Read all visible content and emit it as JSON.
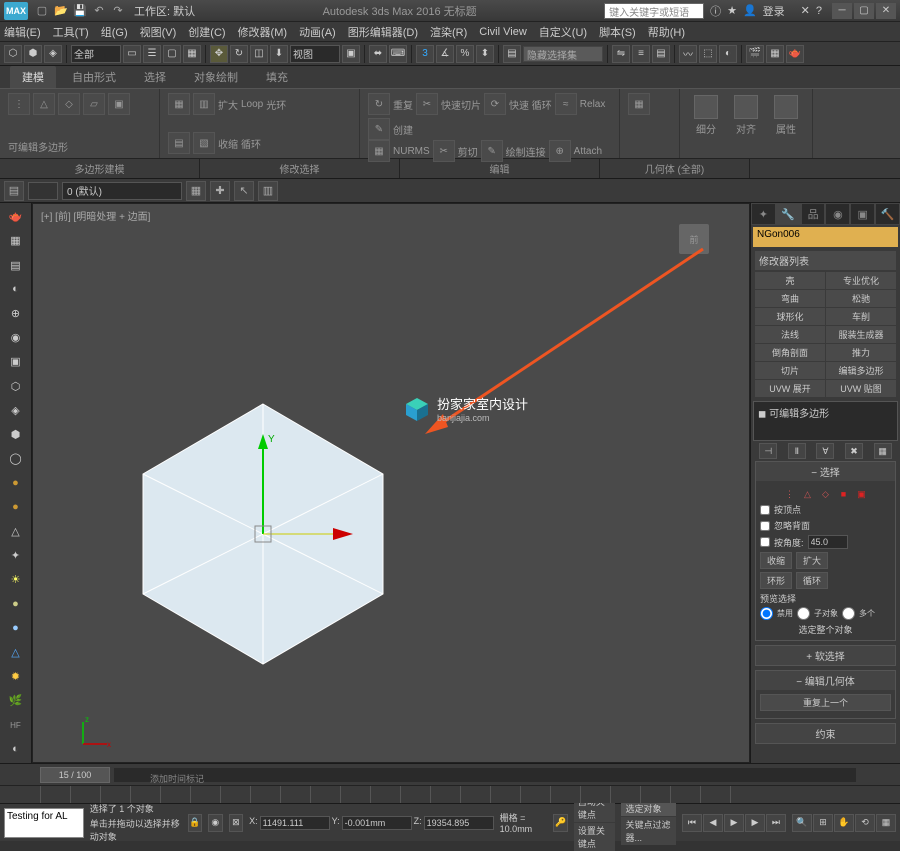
{
  "titlebar": {
    "logo": "MAX",
    "workspace": "工作区: 默认",
    "title": "Autodesk 3ds Max 2016   无标题",
    "search_ph": "键入关键字或短语",
    "login": "登录"
  },
  "menubar": [
    "编辑(E)",
    "工具(T)",
    "组(G)",
    "视图(V)",
    "创建(C)",
    "修改器(M)",
    "动画(A)",
    "图形编辑器(D)",
    "渲染(R)",
    "Civil View",
    "自定义(U)",
    "脚本(S)",
    "帮助(H)"
  ],
  "maintb": {
    "all": "全部",
    "view": "视图",
    "selset_ph": "隐藏选择集"
  },
  "ribbon": {
    "tabs": [
      "建模",
      "自由形式",
      "选择",
      "对象绘制",
      "填充"
    ],
    "groups": {
      "g1": {
        "label": "可编辑多边形"
      },
      "g2": {
        "label": "修改选择",
        "items": [
          "扩大",
          "收缩",
          "Loop",
          "循环",
          "光环"
        ]
      },
      "g3": {
        "label": "编辑",
        "items": [
          "重复",
          "快速切片",
          "快速 循环",
          "Relax",
          "创建",
          "NURMS",
          "剪切",
          "绘制连接",
          "Attach"
        ]
      },
      "g4": {
        "label": "几何体 (全部)"
      },
      "big": [
        "细分",
        "对齐",
        "属性"
      ]
    },
    "footer": [
      "多边形建模",
      "修改选择",
      "编辑",
      "几何体 (全部)"
    ]
  },
  "layerbar": {
    "layer": "0 (默认)"
  },
  "viewport": {
    "label": "[+] [前] [明暗处理 + 边面]",
    "navlabel": "前",
    "timeslider": "15 / 100"
  },
  "watermark": {
    "line1": "扮家家室内设计",
    "line2": "banjiajia.com"
  },
  "cmdpanel": {
    "objname": "NGon006",
    "modlist_hdr": "修改器列表",
    "mods": [
      "壳",
      "专业优化",
      "弯曲",
      "松驰",
      "球形化",
      "车削",
      "法线",
      "服装生成器",
      "倒角剖面",
      "推力",
      "切片",
      "编辑多边形",
      "UVW 展开",
      "UVW 贴图"
    ],
    "stack_item": "可编辑多边形",
    "rollouts": {
      "selection": {
        "title": "选择",
        "byVertex": "按顶点",
        "ignoreBack": "忽略背面",
        "byAngle": "按角度:",
        "angleVal": "45.0",
        "shrink": "收缩",
        "grow": "扩大",
        "ring": "环形",
        "loop": "循环",
        "preview": "预览选择",
        "off": "禁用",
        "subobj": "子对象",
        "multi": "多个",
        "selectAll": "选定整个对象"
      },
      "soft": {
        "title": "软选择"
      },
      "editgeom": {
        "title": "编辑几何体",
        "repeat": "重复上一个"
      },
      "constraints": {
        "title": "约束"
      }
    }
  },
  "status": {
    "test": "Testing for AL",
    "selinfo": "选择了 1 个对象",
    "hint": "单击并拖动以选择并移动对象",
    "x": "11491.111",
    "y": "-0.001mm",
    "z": "19354.895",
    "grid": "栅格 = 10.0mm",
    "addtime": "添加时间标记",
    "autokey": "自动关键点",
    "setkey": "设置关键点",
    "selobj": "选定对象",
    "keyfilter": "关键点过滤器..."
  }
}
